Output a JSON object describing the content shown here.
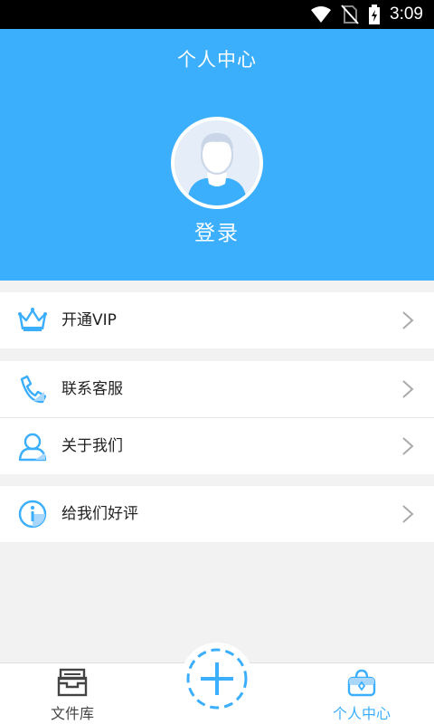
{
  "status_bar": {
    "time": "3:09"
  },
  "header": {
    "title": "个人中心",
    "login_label": "登录"
  },
  "menu": [
    {
      "label": "开通VIP",
      "icon": "crown-icon"
    },
    {
      "label": "联系客服",
      "icon": "phone-icon"
    },
    {
      "label": "关于我们",
      "icon": "person-icon"
    },
    {
      "label": "给我们好评",
      "icon": "info-icon"
    }
  ],
  "bottom_nav": {
    "files_label": "文件库",
    "profile_label": "个人中心"
  },
  "colors": {
    "accent": "#3baefc",
    "background": "#f2f2f2"
  }
}
